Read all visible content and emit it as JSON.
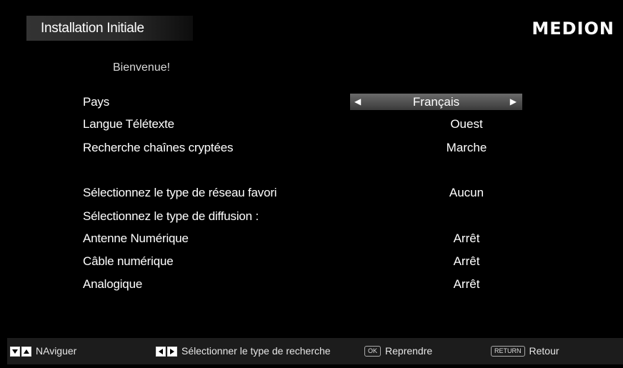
{
  "header": {
    "title": "Installation Initiale",
    "brand": "MEDION"
  },
  "welcome": "Bienvenue!",
  "settings": [
    {
      "label": "Pays",
      "value": "Français"
    },
    {
      "label": "Langue Télétexte",
      "value": "Ouest"
    },
    {
      "label": "Recherche chaînes cryptées",
      "value": "Marche"
    },
    {
      "label": "Sélectionnez le type de réseau favori",
      "value": "Aucun"
    },
    {
      "label": "Sélectionnez le type de diffusion :",
      "value": ""
    },
    {
      "label": "Antenne Numérique",
      "value": "Arrêt"
    },
    {
      "label": "Câble numérique",
      "value": "Arrêt"
    },
    {
      "label": "Analogique",
      "value": "Arrêt"
    }
  ],
  "footer": {
    "navigate": "NAviguer",
    "select_type": "Sélectionner le type de recherche",
    "ok_key": "OK",
    "resume": "Reprendre",
    "return_key": "RETURN",
    "back": "Retour"
  },
  "colors": {
    "background": "#000000",
    "selector": "#5a5a5a",
    "footer": "#1c1c1c"
  }
}
